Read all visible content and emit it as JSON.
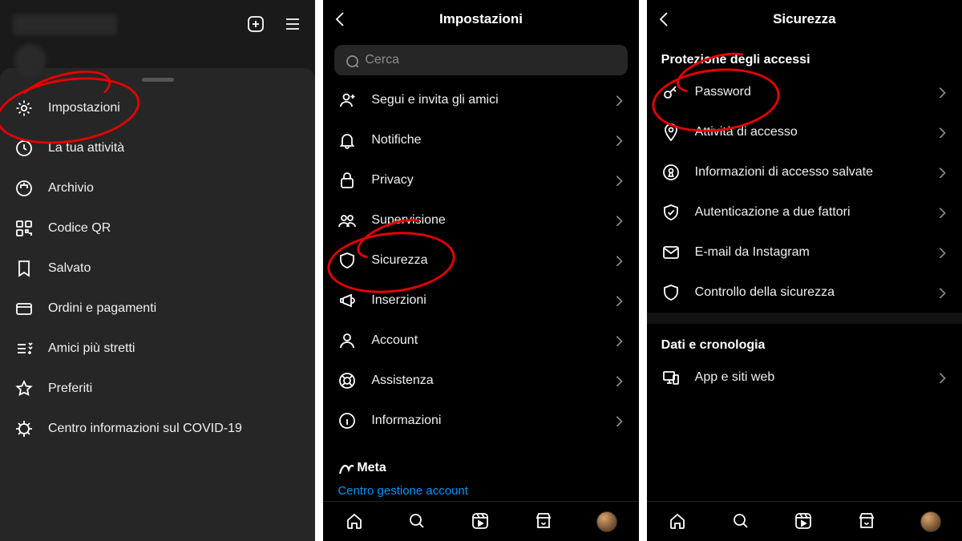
{
  "pane1": {
    "sheet_items": [
      {
        "label": "Impostazioni",
        "icon": "gear"
      },
      {
        "label": "La tua attività",
        "icon": "activity"
      },
      {
        "label": "Archivio",
        "icon": "archive"
      },
      {
        "label": "Codice QR",
        "icon": "qr"
      },
      {
        "label": "Salvato",
        "icon": "bookmark"
      },
      {
        "label": "Ordini e pagamenti",
        "icon": "card"
      },
      {
        "label": "Amici più stretti",
        "icon": "closefriends"
      },
      {
        "label": "Preferiti",
        "icon": "star"
      },
      {
        "label": "Centro informazioni sul COVID-19",
        "icon": "covid"
      }
    ]
  },
  "pane2": {
    "title": "Impostazioni",
    "search_placeholder": "Cerca",
    "items": [
      {
        "label": "Segui e invita gli amici",
        "icon": "personplus"
      },
      {
        "label": "Notifiche",
        "icon": "bell"
      },
      {
        "label": "Privacy",
        "icon": "lock"
      },
      {
        "label": "Supervisione",
        "icon": "people"
      },
      {
        "label": "Sicurezza",
        "icon": "shield"
      },
      {
        "label": "Inserzioni",
        "icon": "megaphone"
      },
      {
        "label": "Account",
        "icon": "person"
      },
      {
        "label": "Assistenza",
        "icon": "lifebuoy"
      },
      {
        "label": "Informazioni",
        "icon": "info"
      }
    ],
    "meta_brand": "Meta",
    "meta_link": "Centro gestione account"
  },
  "pane3": {
    "title": "Sicurezza",
    "section1": "Protezione degli accessi",
    "items1": [
      {
        "label": "Password",
        "icon": "key"
      },
      {
        "label": "Attività di accesso",
        "icon": "pin"
      },
      {
        "label": "Informazioni di accesso salvate",
        "icon": "keyhole"
      },
      {
        "label": "Autenticazione a due fattori",
        "icon": "shieldcheck"
      },
      {
        "label": "E-mail da Instagram",
        "icon": "mail"
      },
      {
        "label": "Controllo della sicurezza",
        "icon": "shield"
      }
    ],
    "section2": "Dati e cronologia",
    "items2": [
      {
        "label": "App e siti web",
        "icon": "devices"
      }
    ]
  }
}
